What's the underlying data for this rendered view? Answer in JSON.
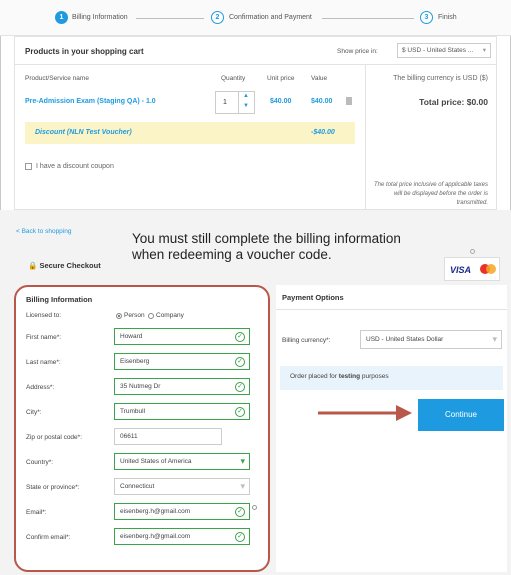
{
  "steps": [
    {
      "num": "1",
      "label": "Billing Information"
    },
    {
      "num": "2",
      "label": "Confirmation and Payment"
    },
    {
      "num": "3",
      "label": "Finish"
    }
  ],
  "cart": {
    "title": "Products in your shopping cart",
    "show_price_label": "Show price in:",
    "currency_select": "$ USD - United States ...",
    "headers": {
      "name": "Product/Service name",
      "quantity": "Quantity",
      "unit_price": "Unit price",
      "value": "Value"
    },
    "item": {
      "name": "Pre-Admission Exam (Staging QA) - 1.0",
      "quantity": "1",
      "unit_price": "$40.00",
      "value": "$40.00"
    },
    "discount": {
      "name": "Discount (NLN Test Voucher)",
      "value": "-$40.00"
    },
    "coupon_label": "I have a discount coupon",
    "billing_currency_note": "The billing currency is USD ($)",
    "total_label": "Total price: $0.00",
    "tax_note_1": "The total price inclusive of applicable taxes",
    "tax_note_2": "will be displayed before the order is",
    "tax_note_3": "transmitted."
  },
  "back_link": "< Back to shopping",
  "secure_checkout": "Secure Checkout",
  "callout_1": "You must still complete the billing information",
  "callout_2": "when redeeming a voucher code.",
  "card_logos": {
    "visa": "VISA",
    "mc": "mastercard"
  },
  "billing": {
    "title": "Billing Information",
    "licensed_label": "Licensed to:",
    "person": "Person",
    "company": "Company",
    "first_name_label": "First name*:",
    "first_name": "Howard",
    "last_name_label": "Last name*:",
    "last_name": "Eisenberg",
    "address_label": "Address*:",
    "address": "35 Nutmeg Dr",
    "city_label": "City*:",
    "city": "Trumbull",
    "zip_label": "Zip or postal code*:",
    "zip": "06611",
    "country_label": "Country*:",
    "country": "United States of America",
    "state_label": "State or province*:",
    "state": "Connecticut",
    "email_label": "Email*:",
    "email": "eisenberg.h@gmail.com",
    "confirm_email_label": "Confirm email*:",
    "confirm_email": "eisenberg.h@gmail.com"
  },
  "payment": {
    "title": "Payment Options",
    "currency_label": "Billing currency*:",
    "currency_value": "USD - United States Dollar",
    "testing_pre": "Order placed for ",
    "testing_bold": "testing",
    "testing_post": " purposes",
    "continue": "Continue"
  },
  "colors": {
    "accent": "#1e9be0",
    "valid": "#3ba34a",
    "highlight": "#b8574a"
  }
}
